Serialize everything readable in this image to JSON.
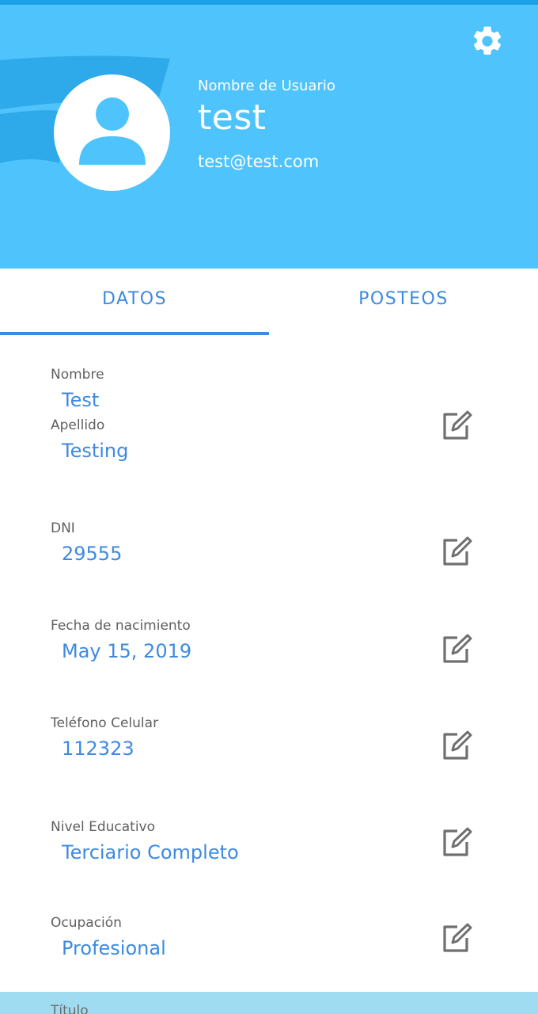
{
  "header": {
    "user_label": "Nombre de Usuario",
    "username": "test",
    "email": "test@test.com",
    "icons": {
      "avatar": "person-icon",
      "settings": "gear-icon"
    },
    "colors": {
      "background": "#4fc3fc",
      "top_strip": "#1aa0e6",
      "text": "#ffffff"
    }
  },
  "tabs": [
    {
      "label": "DATOS",
      "active": true
    },
    {
      "label": "POSTEOS",
      "active": false
    }
  ],
  "fields": {
    "nombre": {
      "label": "Nombre",
      "value": "Test"
    },
    "apellido": {
      "label": "Apellido",
      "value": "Testing"
    },
    "dni": {
      "label": "DNI",
      "value": "29555"
    },
    "fecha": {
      "label": "Fecha de nacimiento",
      "value": "May 15, 2019"
    },
    "telefono": {
      "label": "Teléfono Celular",
      "value": "112323"
    },
    "nivel": {
      "label": "Nivel Educativo",
      "value": "Terciario Completo"
    },
    "ocupacion": {
      "label": "Ocupación",
      "value": "Profesional"
    },
    "titulo": {
      "label": "Título"
    }
  },
  "edit_icon": "edit-icon",
  "colors": {
    "accent": "#3d8ae0",
    "label": "#5f5f5f",
    "icon": "#6f6f6f"
  }
}
